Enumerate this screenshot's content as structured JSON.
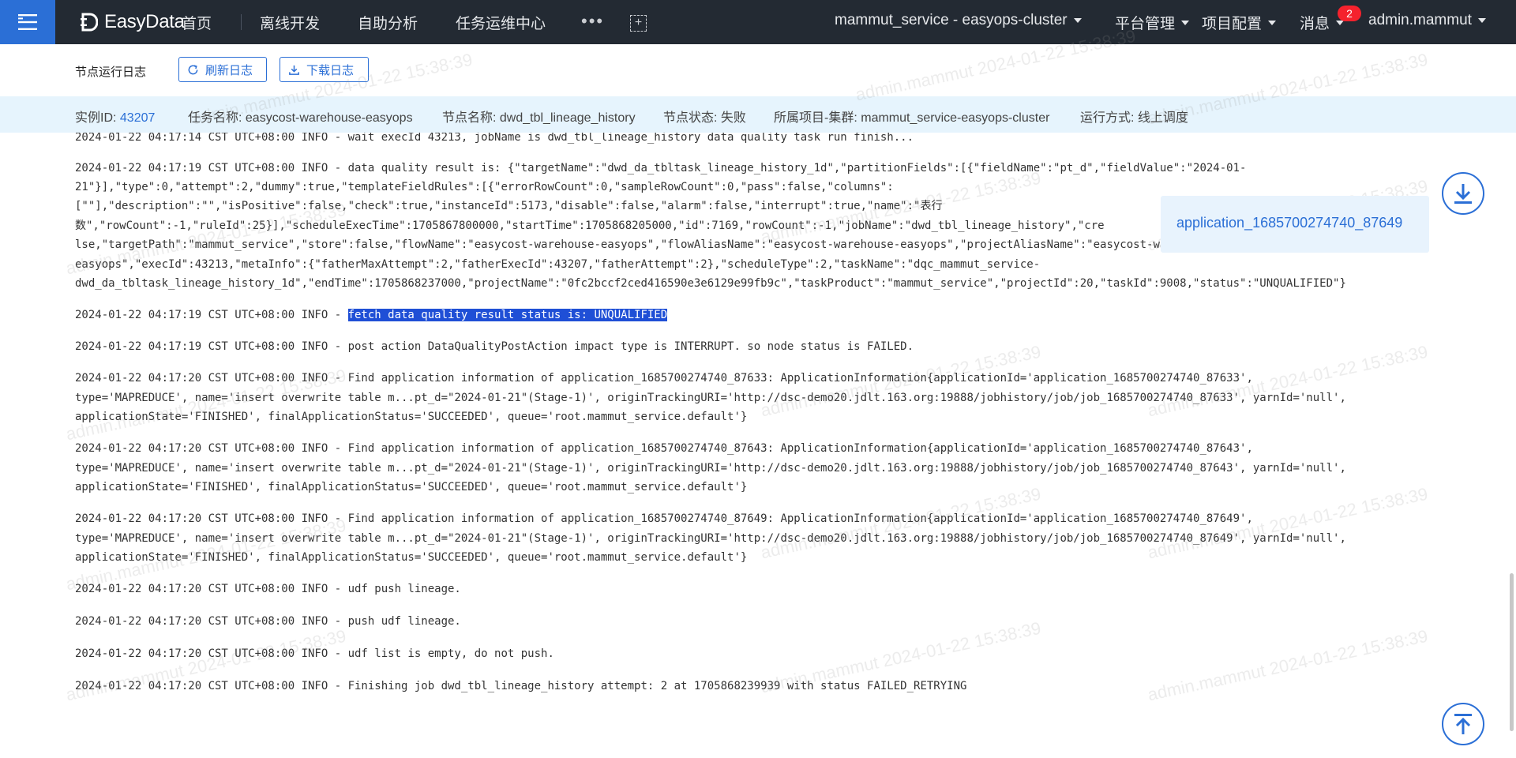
{
  "app": {
    "logo_text": "EasyData",
    "nav": [
      "首页",
      "离线开发",
      "自助分析",
      "任务运维中心"
    ],
    "more": "•••",
    "project": "mammut_service - easyops-cluster",
    "platform": "平台管理",
    "project_config": "项目配置",
    "messages": "消息",
    "message_count": "2",
    "user": "admin.mammut"
  },
  "toolbar": {
    "title": "节点运行日志",
    "refresh_label": "刷新日志",
    "download_label": "下载日志"
  },
  "info": {
    "instance_label": "实例ID:",
    "instance_value": "43207",
    "task_label": "任务名称:",
    "task_value": "easycost-warehouse-easyops",
    "node_label": "节点名称:",
    "node_value": "dwd_tbl_lineage_history",
    "status_label": "节点状态:",
    "status_value": "失败",
    "cluster_label": "所属项目-集群:",
    "cluster_value": "mammut_service-easyops-cluster",
    "mode_label": "运行方式:",
    "mode_value": "线上调度"
  },
  "tooltip": {
    "app_id": "application_1685700274740_87649"
  },
  "watermark": "admin.mammut 2024-01-22 15:38:39",
  "log": {
    "l0": "2024-01-22 04:17:14 CST UTC+08:00 INFO - wait execId 43213, jobName is dwd_tbl_lineage_history data quality task run finish...",
    "l1a": "2024-01-22 04:17:19 CST UTC+08:00 INFO - data quality result is: {\"targetName\":\"dwd_da_tbltask_lineage_history_1d\",\"partitionFields\":[{\"fieldName\":\"pt_d\",\"fieldValue\":\"2024-01-",
    "l1b": "21\"}],\"type\":0,\"attempt\":2,\"dummy\":true,\"templateFieldRules\":[{\"errorRowCount\":0,\"sampleRowCount\":0,\"pass\":false,\"columns\":",
    "l1c": "[\"\"],\"description\":\"\",\"isPositive\":false,\"check\":true,\"instanceId\":5173,\"disable\":false,\"alarm\":false,\"interrupt\":true,\"name\":\"表行",
    "l1d": "数\",\"rowCount\":-1,\"ruleId\":25}],\"scheduleExecTime\":1705867800000,\"startTime\":1705868205000,\"id\":7169,\"rowCount\":-1,\"jobName\":\"dwd_tbl_lineage_history\",\"cre",
    "l1e": "lse,\"targetPath\":\"mammut_service\",\"store\":false,\"flowName\":\"easycost-warehouse-easyops\",\"flowAliasName\":\"easycost-warehouse-easyops\",\"projectAliasName\":\"easycost-warehouse-",
    "l1f": "easyops\",\"execId\":43213,\"metaInfo\":{\"fatherMaxAttempt\":2,\"fatherExecId\":43207,\"fatherAttempt\":2},\"scheduleType\":2,\"taskName\":\"dqc_mammut_service-",
    "l1g": "dwd_da_tbltask_lineage_history_1d\",\"endTime\":1705868237000,\"projectName\":\"0fc2bccf2ced416590e3e6129e99fb9c\",\"taskProduct\":\"mammut_service\",\"projectId\":20,\"taskId\":9008,\"status\":\"UNQUALIFIED\"}",
    "l2_prefix": "2024-01-22 04:17:19 CST UTC+08:00 INFO - ",
    "l2_highlight": "fetch data quality result status is: UNQUALIFIED",
    "l3": "2024-01-22 04:17:19 CST UTC+08:00 INFO - post action DataQualityPostAction impact type is INTERRUPT. so node status is FAILED.",
    "l4a": "2024-01-22 04:17:20 CST UTC+08:00 INFO - Find application information of application_1685700274740_87633: ApplicationInformation{applicationId='application_1685700274740_87633',",
    "l4b": "type='MAPREDUCE', name='insert overwrite table m...pt_d=\"2024-01-21\"(Stage-1)', originTrackingURI='http://dsc-demo20.jdlt.163.org:19888/jobhistory/job/job_1685700274740_87633', yarnId='null',",
    "l4c": "applicationState='FINISHED', finalApplicationStatus='SUCCEEDED', queue='root.mammut_service.default'}",
    "l5a": "2024-01-22 04:17:20 CST UTC+08:00 INFO - Find application information of application_1685700274740_87643: ApplicationInformation{applicationId='application_1685700274740_87643',",
    "l5b": "type='MAPREDUCE', name='insert overwrite table m...pt_d=\"2024-01-21\"(Stage-1)', originTrackingURI='http://dsc-demo20.jdlt.163.org:19888/jobhistory/job/job_1685700274740_87643', yarnId='null',",
    "l5c": "applicationState='FINISHED', finalApplicationStatus='SUCCEEDED', queue='root.mammut_service.default'}",
    "l6a": "2024-01-22 04:17:20 CST UTC+08:00 INFO - Find application information of application_1685700274740_87649: ApplicationInformation{applicationId='application_1685700274740_87649',",
    "l6b": "type='MAPREDUCE', name='insert overwrite table m...pt_d=\"2024-01-21\"(Stage-1)', originTrackingURI='http://dsc-demo20.jdlt.163.org:19888/jobhistory/job/job_1685700274740_87649', yarnId='null',",
    "l6c": "applicationState='FINISHED', finalApplicationStatus='SUCCEEDED', queue='root.mammut_service.default'}",
    "l7": "2024-01-22 04:17:20 CST UTC+08:00 INFO - udf push lineage.",
    "l8": "2024-01-22 04:17:20 CST UTC+08:00 INFO - push udf lineage.",
    "l9": "2024-01-22 04:17:20 CST UTC+08:00 INFO - udf list is empty, do not push.",
    "l10": "2024-01-22 04:17:20 CST UTC+08:00 INFO - Finishing job dwd_tbl_lineage_history attempt: 2 at 1705868239939 with status FAILED_RETRYING"
  },
  "icons": {
    "menu": "hamburger-icon",
    "refresh": "refresh-icon",
    "download": "download-icon",
    "scroll_down": "arrow-down-circle-icon",
    "scroll_top": "arrow-up-circle-icon"
  },
  "colors": {
    "accent": "#2b6fd6",
    "nav_bg": "#232a33",
    "info_bg": "#e6f4fd",
    "highlight": "#1f4fd6",
    "badge": "#f5222d"
  }
}
